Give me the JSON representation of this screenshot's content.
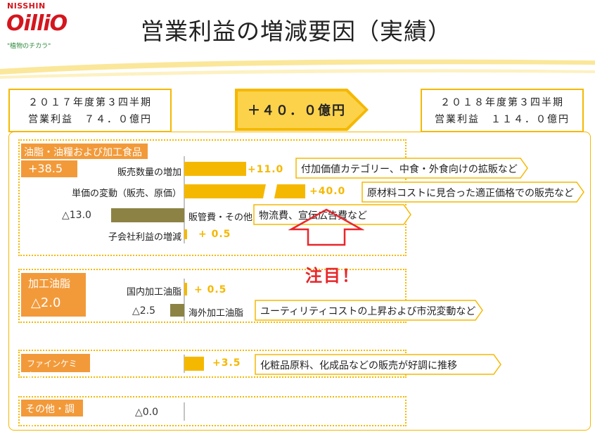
{
  "logo": {
    "brand": "NISSHIN",
    "name": "OilliO",
    "tagline": "\"植物のチカラ\""
  },
  "title": "営業利益の増減要因（実績）",
  "left_kpi": {
    "line1": "２０１７年度第３四半期",
    "line2": "営業利益　７４．０億円"
  },
  "center_kpi": {
    "label": "＋４０．０億円"
  },
  "right_kpi": {
    "line1": "２０１８年度第３四半期",
    "line2": "営業利益　１１４．０億円"
  },
  "annotation": "注目！",
  "chart_data": {
    "type": "bar",
    "title": "",
    "unit": "億円",
    "segments": [
      {
        "name": "油脂・油糧および加工食品",
        "total_label": "+38.5",
        "total": 38.5,
        "items": [
          {
            "label": "販売数量の増加",
            "value": 11.0,
            "value_label": "+11.0",
            "comment": "付加価値カテゴリー、中食・外食向けの拡販など"
          },
          {
            "label": "単価の変動（販売、原価）",
            "value": 40.0,
            "value_label": "+40.0",
            "comment": "原材料コストに見合った適正価格での販売など"
          },
          {
            "label": "販管費・その他",
            "value": -13.0,
            "value_label": "△13.0",
            "comment": "物流費、宣伝広告費など"
          },
          {
            "label": "子会社利益の増減",
            "value": 0.5,
            "value_label": "+ 0.5",
            "comment": ""
          }
        ]
      },
      {
        "name": "加工油脂",
        "total_label": "△2.0",
        "total": -2.0,
        "items": [
          {
            "label": "国内加工油脂",
            "value": 0.5,
            "value_label": "+ 0.5",
            "comment": ""
          },
          {
            "label": "海外加工油脂",
            "value": -2.5,
            "value_label": "△2.5",
            "comment": "ユーティリティコストの上昇および市況変動など"
          }
        ]
      },
      {
        "name": "ファインケミカル",
        "total_label": "",
        "total": 3.5,
        "items": [
          {
            "label": "",
            "value": 3.5,
            "value_label": "+3.5",
            "comment": "化粧品原料、化成品などの販売が好調に推移"
          }
        ]
      },
      {
        "name": "その他・調整",
        "total_label": "",
        "total": 0.0,
        "items": [
          {
            "label": "",
            "value": 0.0,
            "value_label": "△0.0",
            "comment": ""
          }
        ]
      }
    ],
    "colors": {
      "positive": "#f5b800",
      "negative": "#8c8244",
      "segment": "#f29a3a",
      "emphasis": "#e8262b"
    }
  }
}
